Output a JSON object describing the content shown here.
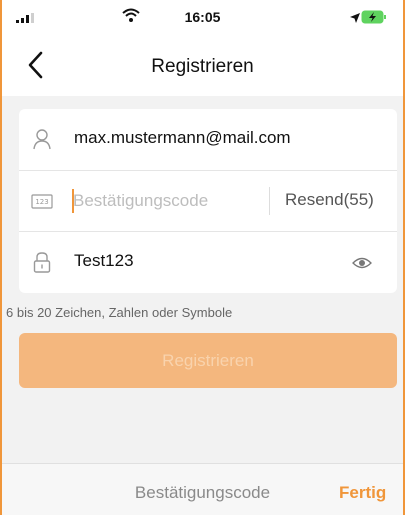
{
  "status_bar": {
    "time": "16:05"
  },
  "nav": {
    "title": "Registrieren"
  },
  "form": {
    "email_value": "max.mustermann@mail.com",
    "code_placeholder": "Bestätigungscode",
    "code_value": "",
    "resend_label": "Resend(55)",
    "password_value": "Test123"
  },
  "hint": "6 bis 20 Zeichen, Zahlen oder Symbole",
  "register_button_label": "Registrieren",
  "keyboard_bar": {
    "title": "Bestätigungscode",
    "done_label": "Fertig"
  },
  "colors": {
    "accent": "#f0963a",
    "button_disabled": "#f4b77e",
    "background": "#f2f2f2"
  },
  "icons": [
    "signal-icon",
    "wifi-icon",
    "location-icon",
    "battery-charging-icon",
    "back-chevron-icon",
    "user-icon",
    "code-123-icon",
    "lock-icon",
    "eye-icon"
  ]
}
